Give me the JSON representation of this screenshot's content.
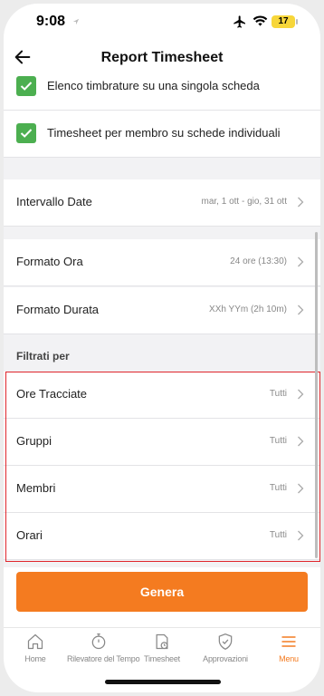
{
  "status": {
    "time": "9:08",
    "battery": "17"
  },
  "header": {
    "title": "Report Timesheet"
  },
  "options": [
    {
      "label": "Elenco timbrature su una singola scheda",
      "checked": true
    },
    {
      "label": "Timesheet per membro su schede individuali",
      "checked": true
    }
  ],
  "settings": {
    "date_range": {
      "label": "Intervallo Date",
      "value": "mar, 1 ott - gio, 31 ott"
    },
    "time_format": {
      "label": "Formato Ora",
      "value": "24 ore (13:30)"
    },
    "duration_format": {
      "label": "Formato Durata",
      "value": "XXh YYm (2h 10m)"
    }
  },
  "filters": {
    "heading": "Filtrati per",
    "items": [
      {
        "label": "Ore Tracciate",
        "value": "Tutti"
      },
      {
        "label": "Gruppi",
        "value": "Tutti"
      },
      {
        "label": "Membri",
        "value": "Tutti"
      },
      {
        "label": "Orari",
        "value": "Tutti"
      }
    ]
  },
  "generate_label": "Genera",
  "tabbar": [
    {
      "label": "Home",
      "icon": "home-icon"
    },
    {
      "label": "Rilevatore del Tempo",
      "icon": "stopwatch-icon"
    },
    {
      "label": "Timesheet",
      "icon": "timesheet-icon"
    },
    {
      "label": "Approvazioni",
      "icon": "shield-check-icon"
    },
    {
      "label": "Menu",
      "icon": "menu-icon",
      "active": true
    }
  ],
  "colors": {
    "accent": "#f47b20",
    "check": "#4caf50",
    "highlight": "#e0262c"
  }
}
